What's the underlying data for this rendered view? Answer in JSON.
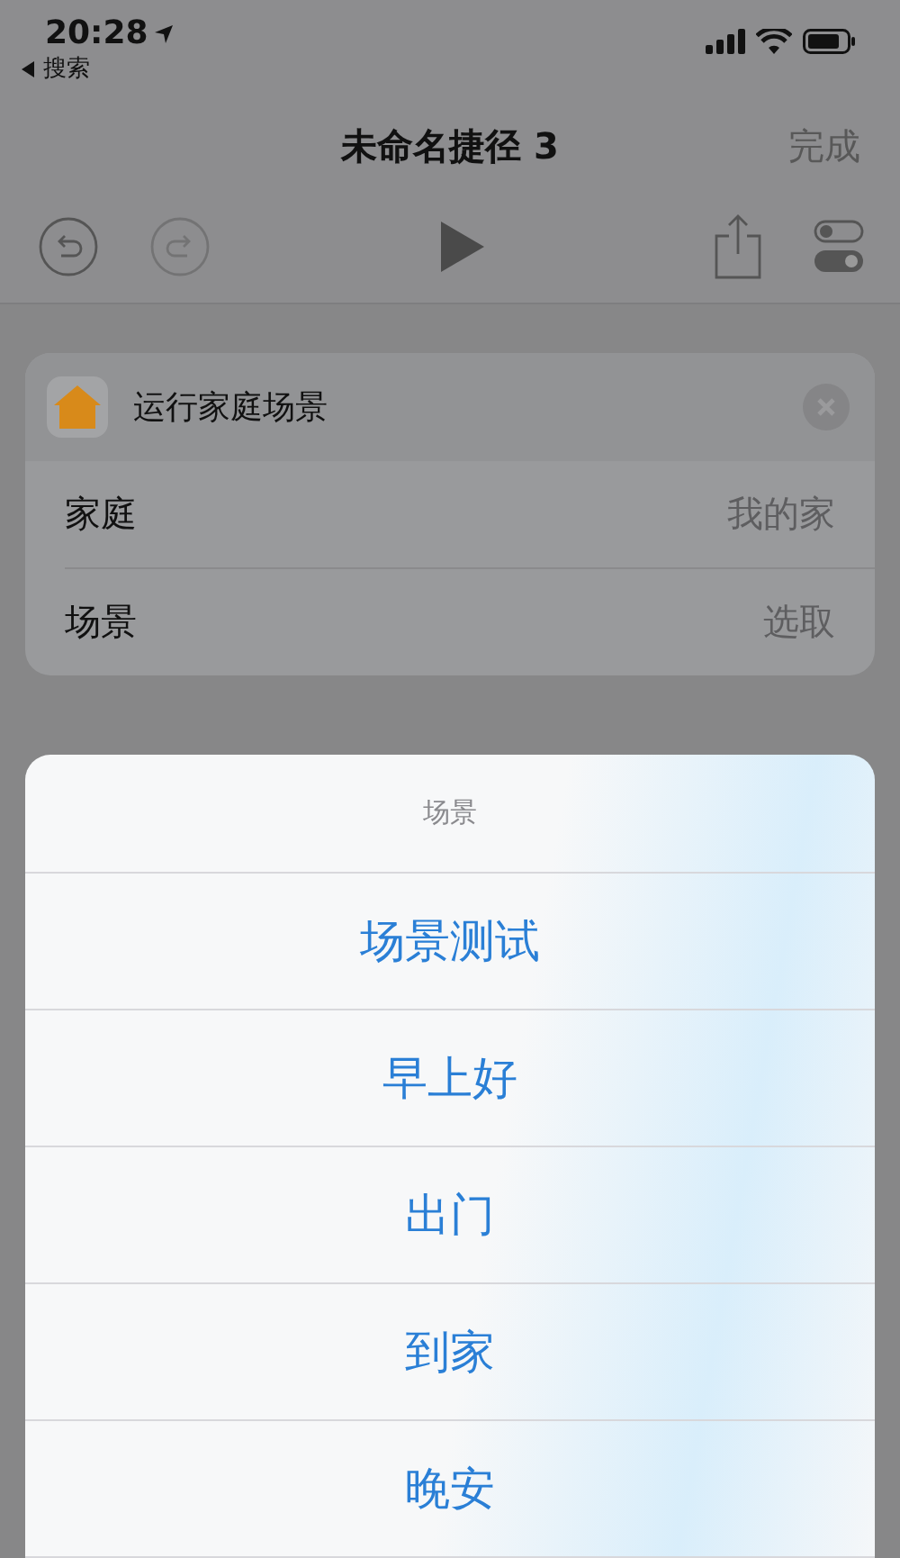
{
  "status_bar": {
    "time": "20:28",
    "back_label": "搜索"
  },
  "nav": {
    "title": "未命名捷径 3",
    "done": "完成"
  },
  "toolbar": {
    "undo_disabled": false,
    "redo_disabled": true
  },
  "action_card": {
    "title": "运行家庭场景",
    "rows": [
      {
        "label": "家庭",
        "value": "我的家"
      },
      {
        "label": "场景",
        "value": "选取"
      }
    ]
  },
  "sheet": {
    "title": "场景",
    "options": [
      "场景测试",
      "早上好",
      "出门",
      "到家",
      "晚安"
    ]
  }
}
